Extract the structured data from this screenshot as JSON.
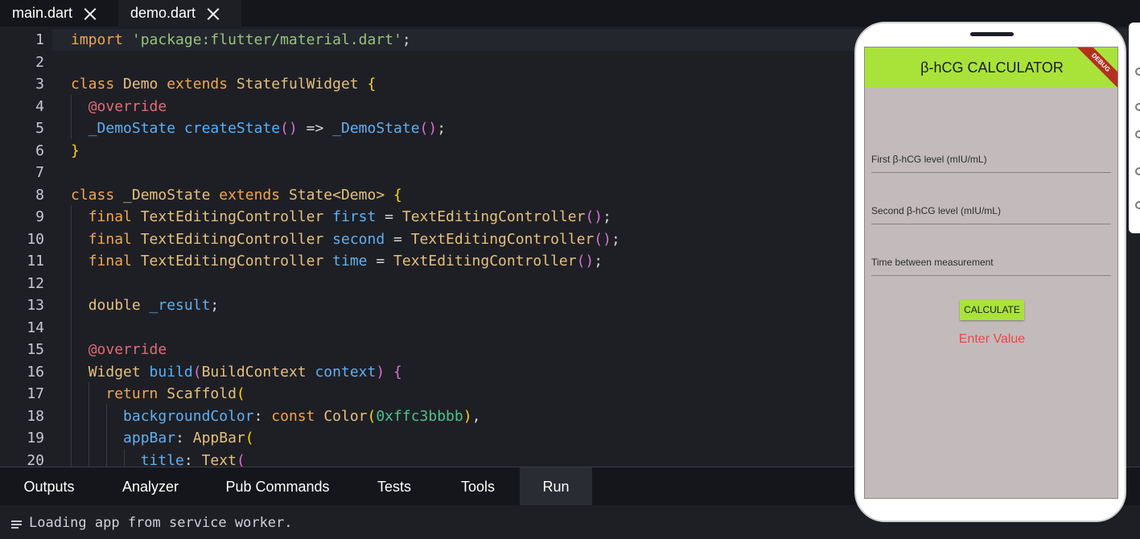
{
  "tabs": [
    {
      "label": "main.dart",
      "active": false
    },
    {
      "label": "demo.dart",
      "active": true
    }
  ],
  "editor": {
    "lines": [
      {
        "n": "1",
        "tokens": [
          [
            "kw",
            "import "
          ],
          [
            "str",
            "'package:flutter/material.dart'"
          ],
          [
            "punc",
            ";"
          ]
        ]
      },
      {
        "n": "2",
        "tokens": []
      },
      {
        "n": "3",
        "tokens": [
          [
            "kw",
            "class "
          ],
          [
            "cls",
            "Demo "
          ],
          [
            "kw",
            "extends "
          ],
          [
            "cls",
            "StatefulWidget "
          ],
          [
            "p1",
            "{"
          ]
        ]
      },
      {
        "n": "4",
        "tokens": [
          [
            "punc",
            "  "
          ],
          [
            "ann",
            "@override"
          ]
        ]
      },
      {
        "n": "5",
        "tokens": [
          [
            "punc",
            "  "
          ],
          [
            "var",
            "_DemoState "
          ],
          [
            "fn",
            "createState"
          ],
          [
            "p2",
            "()"
          ],
          [
            "punc",
            " => "
          ],
          [
            "var",
            "_DemoState"
          ],
          [
            "p2",
            "()"
          ],
          [
            "punc",
            ";"
          ]
        ]
      },
      {
        "n": "6",
        "tokens": [
          [
            "p1",
            "}"
          ]
        ]
      },
      {
        "n": "7",
        "tokens": []
      },
      {
        "n": "8",
        "tokens": [
          [
            "kw",
            "class "
          ],
          [
            "cls",
            "_DemoState "
          ],
          [
            "kw",
            "extends "
          ],
          [
            "cls",
            "State<Demo> "
          ],
          [
            "p1",
            "{"
          ]
        ]
      },
      {
        "n": "9",
        "tokens": [
          [
            "punc",
            "  "
          ],
          [
            "kw",
            "final "
          ],
          [
            "cls",
            "TextEditingController "
          ],
          [
            "var",
            "first "
          ],
          [
            "punc",
            "= "
          ],
          [
            "cls",
            "TextEditingController"
          ],
          [
            "p2",
            "()"
          ],
          [
            "punc",
            ";"
          ]
        ]
      },
      {
        "n": "10",
        "tokens": [
          [
            "punc",
            "  "
          ],
          [
            "kw",
            "final "
          ],
          [
            "cls",
            "TextEditingController "
          ],
          [
            "var",
            "second "
          ],
          [
            "punc",
            "= "
          ],
          [
            "cls",
            "TextEditingController"
          ],
          [
            "p2",
            "()"
          ],
          [
            "punc",
            ";"
          ]
        ]
      },
      {
        "n": "11",
        "tokens": [
          [
            "punc",
            "  "
          ],
          [
            "kw",
            "final "
          ],
          [
            "cls",
            "TextEditingController "
          ],
          [
            "var",
            "time "
          ],
          [
            "punc",
            "= "
          ],
          [
            "cls",
            "TextEditingController"
          ],
          [
            "p2",
            "()"
          ],
          [
            "punc",
            ";"
          ]
        ]
      },
      {
        "n": "12",
        "tokens": []
      },
      {
        "n": "13",
        "tokens": [
          [
            "punc",
            "  "
          ],
          [
            "typ",
            "double "
          ],
          [
            "var",
            "_result"
          ],
          [
            "punc",
            ";"
          ]
        ]
      },
      {
        "n": "14",
        "tokens": []
      },
      {
        "n": "15",
        "tokens": [
          [
            "punc",
            "  "
          ],
          [
            "ann",
            "@override"
          ]
        ]
      },
      {
        "n": "16",
        "tokens": [
          [
            "punc",
            "  "
          ],
          [
            "cls",
            "Widget "
          ],
          [
            "fn",
            "build"
          ],
          [
            "p2",
            "("
          ],
          [
            "cls",
            "BuildContext "
          ],
          [
            "var",
            "context"
          ],
          [
            "p2",
            ") "
          ],
          [
            "p2",
            "{"
          ]
        ]
      },
      {
        "n": "17",
        "tokens": [
          [
            "punc",
            "    "
          ],
          [
            "kw",
            "return "
          ],
          [
            "cls",
            "Scaffold"
          ],
          [
            "p1",
            "("
          ]
        ]
      },
      {
        "n": "18",
        "tokens": [
          [
            "punc",
            "      "
          ],
          [
            "var",
            "backgroundColor"
          ],
          [
            "punc",
            ": "
          ],
          [
            "kw",
            "const "
          ],
          [
            "cls",
            "Color"
          ],
          [
            "p1",
            "("
          ],
          [
            "num",
            "0xffc3bbbb"
          ],
          [
            "p1",
            ")"
          ],
          [
            "punc",
            ","
          ]
        ]
      },
      {
        "n": "19",
        "tokens": [
          [
            "punc",
            "      "
          ],
          [
            "var",
            "appBar"
          ],
          [
            "punc",
            ": "
          ],
          [
            "cls",
            "AppBar"
          ],
          [
            "p1",
            "("
          ]
        ]
      },
      {
        "n": "20",
        "tokens": [
          [
            "punc",
            "        "
          ],
          [
            "var",
            "title"
          ],
          [
            "punc",
            ": "
          ],
          [
            "cls",
            "Text"
          ],
          [
            "p2",
            "("
          ]
        ]
      }
    ]
  },
  "panel": {
    "tabs": [
      {
        "label": "Outputs"
      },
      {
        "label": "Analyzer"
      },
      {
        "label": "Pub Commands"
      },
      {
        "label": "Tests"
      },
      {
        "label": "Tools"
      },
      {
        "label": "Run",
        "active": true
      }
    ],
    "console_text": "Loading app from service worker."
  },
  "app": {
    "title": "β-hCG CALCULATOR",
    "debug_banner": "DEBUG",
    "fields": [
      {
        "label": "First β-hCG level (mIU/mL)"
      },
      {
        "label": "Second β-hCG level (mIU/mL)"
      },
      {
        "label": "Time between measurement"
      }
    ],
    "button": "CALCULATE",
    "result": "Enter Value",
    "colors": {
      "appbar": "#a9e33a",
      "background": "#c3bbbb",
      "result": "#e8484a"
    }
  }
}
